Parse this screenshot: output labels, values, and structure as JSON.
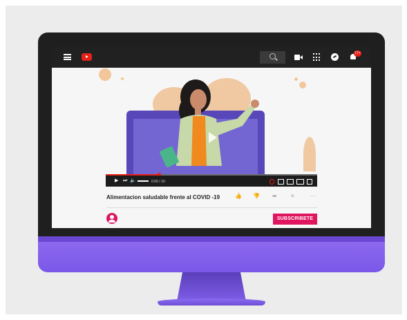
{
  "app": {
    "name": "YouTube",
    "logo_icon": "youtube-logo-icon",
    "accent": "#e62117",
    "brand": "#e0155f"
  },
  "topbar": {
    "icons": [
      "menu-icon",
      "search-icon",
      "video-camera-icon",
      "apps-icon",
      "messages-icon",
      "bell-icon"
    ],
    "notification_badge": "17+"
  },
  "player": {
    "time": "0:00 / 10:",
    "progress": 0.25
  },
  "video": {
    "title": "Alimentacion saludable frente al COVID -19"
  },
  "actions": {
    "like_icon": "thumb-up-icon",
    "dislike_icon": "thumb-down-icon",
    "share_icon": "share-icon",
    "save_icon": "playlist-add-icon",
    "more_label": "···"
  },
  "channel": {
    "subscribe_label": "SUBSCRIBETE"
  }
}
